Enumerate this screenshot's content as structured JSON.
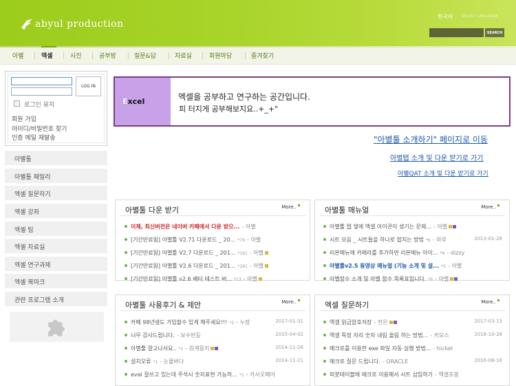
{
  "header": {
    "logo_text": "abyul production",
    "lang_current": "한국어",
    "lang_select": "SELECT LANGUAGE",
    "search_button": "SEARCH"
  },
  "nav": [
    "아별",
    "엑셀",
    "사진",
    "공부방",
    "질문&답",
    "자료실",
    "회원마당",
    "즐겨찾기"
  ],
  "login": {
    "button": "LOG IN",
    "keep": "로그인 유지",
    "links": [
      "회원 가입",
      "아이디/비밀번호 찾기",
      "인증 메일 재발송"
    ]
  },
  "sidebar": [
    "아별툴",
    "아별툴 패밀리",
    "엑셀 질문하기",
    "엑셀 강좌",
    "엑셀 팁",
    "엑셀 자료실",
    "엑셀 연구과제",
    "엑셀 북마크",
    "관련 프로그램 소개"
  ],
  "banner": {
    "logo_first": "E",
    "logo_rest": "xcel",
    "line1": "엑셀을 공부하고 연구하는 공간입니다.",
    "line2": "피 터지게 공부해보지요..+_+\""
  },
  "links": {
    "intro": "\"아별툴 소개하기\" 페이지로 이동",
    "tab": "아별탭 소개 및 다운 받기로 가기",
    "qat": "아별QAT 소개 및 다운 받기로 가기"
  },
  "more_label": "More..",
  "panels": {
    "download": {
      "title": "아별툴 다운 받기",
      "rows": [
        {
          "title": "이제, 최신버전은 네이버 카페에서 다운 받으...",
          "cnt": "",
          "author": "- 아별",
          "date": ""
        },
        {
          "title": "[기간만료됨] 아별툴 V2.71 다운로드 _ 20...",
          "cnt": "*79",
          "author": "- 아별",
          "date": ""
        },
        {
          "title": "[기간만료됨] 아별툴 V2.7 다운로드 _ 201...",
          "cnt": "*161",
          "author": "- 아별",
          "date": ""
        },
        {
          "title": "[기간만료됨] 아별툴 V2.6 다운로드 _ 201...",
          "cnt": "*261",
          "author": "- 아별",
          "date": ""
        },
        {
          "title": "[기간만료됨] 아별툴 v2.6 베타 테스트 버...",
          "cnt": "*13",
          "author": "- 아별",
          "date": ""
        }
      ]
    },
    "manual": {
      "title": "아별툴 매뉴얼",
      "rows": [
        {
          "title": "아별툴 탭 옆에 엑셀 아이콘이 생기는 문제...",
          "cnt": "",
          "author": "- 아별",
          "date": ""
        },
        {
          "title": "시트 모음 _ 시트들을 하나로 합치는 방법",
          "cnt": "*6",
          "author": "- 마루",
          "date": "2013-01-28"
        },
        {
          "title": "리본메뉴에 카메라를 추가하면 리본메뉴 아이...",
          "cnt": "*9",
          "author": "- dizzy",
          "date": ""
        },
        {
          "title": "아별툴v2.5 동영상 매뉴얼 (기능 소개 및 설...",
          "cnt": "*5",
          "author": "- 아별",
          "date": ""
        },
        {
          "title": "아별함수 소개 및 아별 함수 목록표입니다.",
          "cnt": "*6",
          "author": "- 아별",
          "date": ""
        }
      ]
    },
    "review": {
      "title": "아별툴 사용후기 & 제안",
      "rows": [
        {
          "title": "카페 98년생도 가입할수 있게 해주세요!!!",
          "cnt": "*2",
          "author": "- 누장",
          "date": "2017-01-31"
        },
        {
          "title": "너무 감사드립니다.",
          "cnt": "",
          "author": "- 보수반등",
          "date": "2015-04-02"
        },
        {
          "title": "아별툴 깔고나서요..",
          "cnt": "*1",
          "author": "- 원계몽키",
          "date": "2014-11-26"
        },
        {
          "title": "설치오류",
          "cnt": "*1",
          "author": "- 눈물바다",
          "date": "2014-11-21"
        },
        {
          "title": "eval 잘쓰고 있는데 주석시 숫자표현 가능하...",
          "cnt": "*1",
          "author": "- 카시오페아",
          "date": ""
        }
      ]
    },
    "question": {
      "title": "엑셀 질문하기",
      "rows": [
        {
          "title": "엑셀 읽금암호저장",
          "cnt": "",
          "author": "- 전은",
          "date": "2017-03-13"
        },
        {
          "title": "엑셀 특정 자리 숫자 내림 올림 하는 방법...",
          "cnt": "",
          "author": "- 키모스",
          "date": "2016-10-28"
        },
        {
          "title": "매크로를 이용한 exe 파일 자동 실행 방법...",
          "cnt": "",
          "author": "- hickel",
          "date": ""
        },
        {
          "title": "매크로 질문 드립니다.",
          "cnt": "",
          "author": "- ORACLE",
          "date": "2016-08-16"
        },
        {
          "title": "피봇테이블에 매크로 이용해서 시트 삽입하기",
          "cnt": "",
          "author": "- 엑셀초봉",
          "date": ""
        }
      ]
    }
  }
}
